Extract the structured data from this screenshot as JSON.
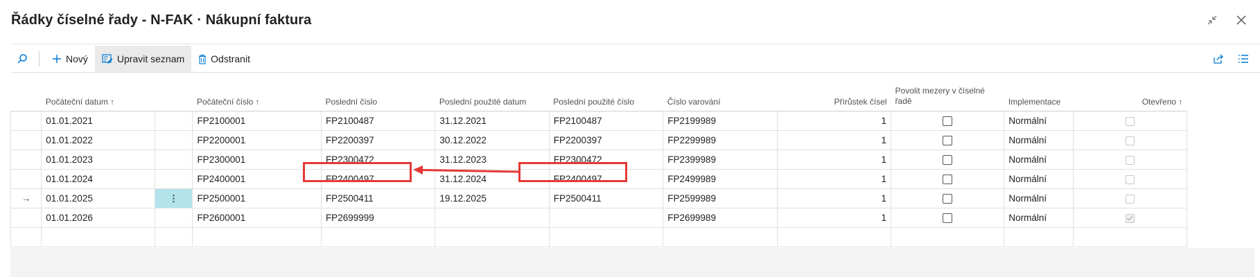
{
  "title": "Řádky číselné řady - N-FAK · Nákupní faktura",
  "toolbar": {
    "new_label": "Nový",
    "edit_list_label": "Upravit seznam",
    "delete_label": "Odstranit"
  },
  "columns": [
    "Počáteční datum ↑",
    "Počáteční číslo ↑",
    "Poslední číslo",
    "Poslední použité datum",
    "Poslední použité číslo",
    "Číslo varování",
    "Přírůstek čísel",
    "Povolit mezery v číselné řadě",
    "Implementace",
    "Otevřeno ↑"
  ],
  "rows": [
    {
      "start_date": "01.01.2021",
      "start_no": "FP2100001",
      "last_no": "FP2100487",
      "last_date": "31.12.2021",
      "last_used": "FP2100487",
      "warning": "FP2199989",
      "increment": "1",
      "gaps": false,
      "impl": "Normální",
      "open": false
    },
    {
      "start_date": "01.01.2022",
      "start_no": "FP2200001",
      "last_no": "FP2200397",
      "last_date": "30.12.2022",
      "last_used": "FP2200397",
      "warning": "FP2299989",
      "increment": "1",
      "gaps": false,
      "impl": "Normální",
      "open": false
    },
    {
      "start_date": "01.01.2023",
      "start_no": "FP2300001",
      "last_no": "FP2300472",
      "last_date": "31.12.2023",
      "last_used": "FP2300472",
      "warning": "FP2399989",
      "increment": "1",
      "gaps": false,
      "impl": "Normální",
      "open": false
    },
    {
      "start_date": "01.01.2024",
      "start_no": "FP2400001",
      "last_no": "FP2400497",
      "last_date": "31.12.2024",
      "last_used": "FP2400497",
      "warning": "FP2499989",
      "increment": "1",
      "gaps": false,
      "impl": "Normální",
      "open": false
    },
    {
      "start_date": "01.01.2025",
      "start_no": "FP2500001",
      "last_no": "FP2500411",
      "last_date": "19.12.2025",
      "last_used": "FP2500411",
      "warning": "FP2599989",
      "increment": "1",
      "gaps": false,
      "impl": "Normální",
      "open": false,
      "selected": true
    },
    {
      "start_date": "01.01.2026",
      "start_no": "FP2600001",
      "last_no": "FP2699999",
      "last_date": "",
      "last_used": "",
      "warning": "FP2699989",
      "increment": "1",
      "gaps": false,
      "impl": "Normální",
      "open": true
    }
  ],
  "row_indicator": "→",
  "row_menu": "⋮",
  "colors": {
    "selection": "#b3e4ec",
    "annotation": "#e53935",
    "accent": "#0078d4"
  }
}
